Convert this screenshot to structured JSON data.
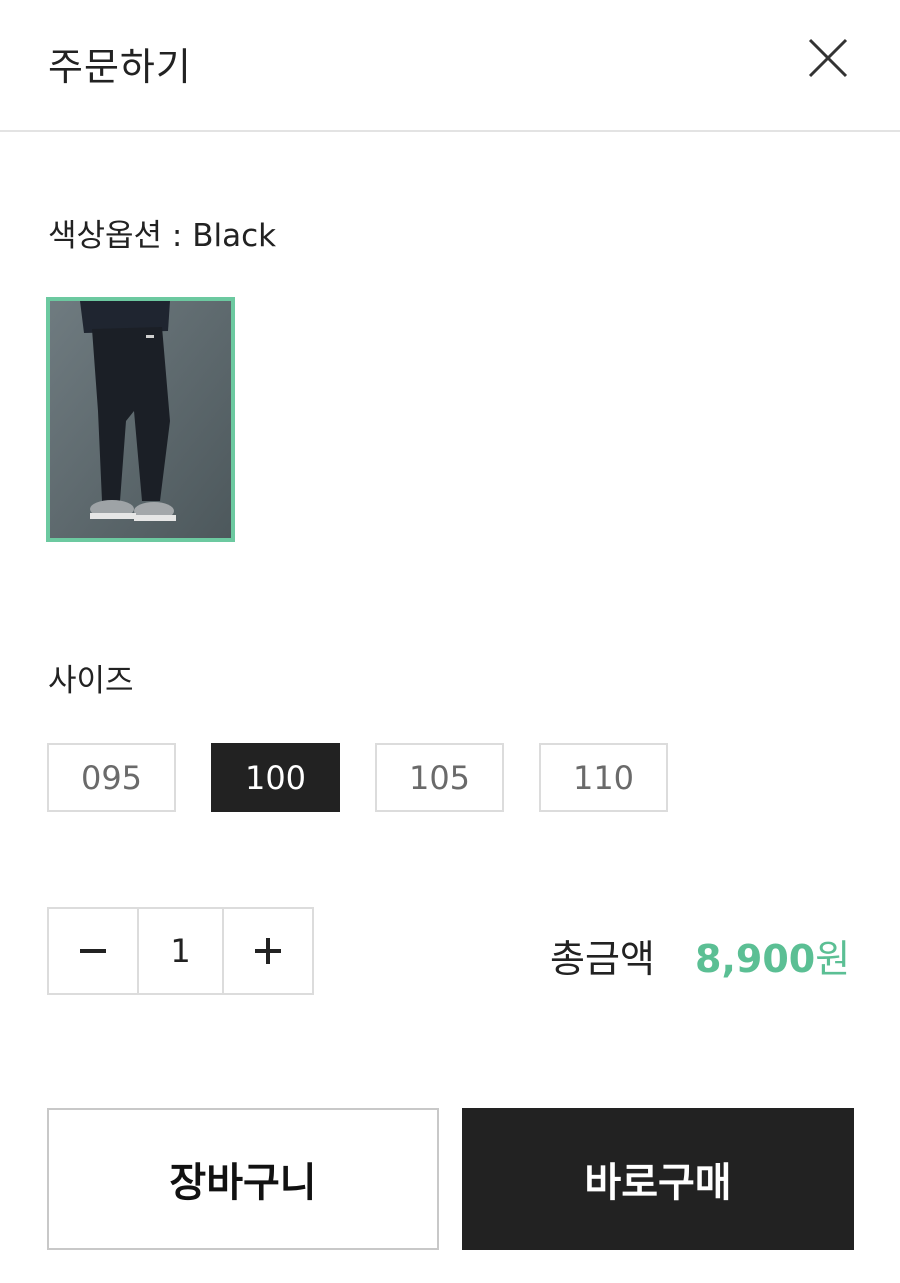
{
  "header": {
    "title": "주문하기",
    "close_icon": "close-icon"
  },
  "color_option": {
    "label": "색상옵션 : Black",
    "selected_swatch": "Black",
    "swatch_border_color": "#6cc9a0"
  },
  "size": {
    "label": "사이즈",
    "options": [
      "095",
      "100",
      "105",
      "110"
    ],
    "selected": "100"
  },
  "quantity": {
    "minus_icon": "minus-icon",
    "value": "1",
    "plus_icon": "plus-icon"
  },
  "total": {
    "label": "총금액",
    "amount": "8,900",
    "unit": "원",
    "accent_color": "#5bbf94"
  },
  "actions": {
    "cart_label": "장바구니",
    "buy_label": "바로구매"
  }
}
